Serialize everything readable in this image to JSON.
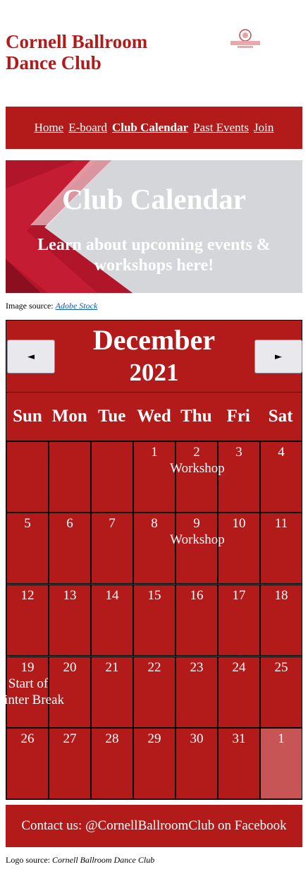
{
  "site": {
    "title": "Cornell Ballroom Dance Club"
  },
  "nav": {
    "items": [
      {
        "label": "Home",
        "active": false
      },
      {
        "label": "E-board",
        "active": false
      },
      {
        "label": "Club Calendar",
        "active": true
      },
      {
        "label": "Past Events",
        "active": false
      },
      {
        "label": "Join",
        "active": false
      }
    ]
  },
  "banner": {
    "title": "Club Calendar",
    "subtitle": "Learn about upcoming events & workshops here!"
  },
  "image_source": {
    "label": "Image source:",
    "link": "Adobe Stock"
  },
  "calendar": {
    "month": "December",
    "year": "2021",
    "prev_label": "◄",
    "next_label": "►",
    "weekdays": [
      "Sun",
      "Mon",
      "Tue",
      "Wed",
      "Thu",
      "Fri",
      "Sat"
    ],
    "weeks": [
      [
        {
          "day": "",
          "event": ""
        },
        {
          "day": "",
          "event": ""
        },
        {
          "day": "",
          "event": ""
        },
        {
          "day": "1",
          "event": ""
        },
        {
          "day": "2",
          "event": "Workshop"
        },
        {
          "day": "3",
          "event": ""
        },
        {
          "day": "4",
          "event": ""
        }
      ],
      [
        {
          "day": "5",
          "event": ""
        },
        {
          "day": "6",
          "event": ""
        },
        {
          "day": "7",
          "event": ""
        },
        {
          "day": "8",
          "event": ""
        },
        {
          "day": "9",
          "event": "Workshop"
        },
        {
          "day": "10",
          "event": ""
        },
        {
          "day": "11",
          "event": ""
        }
      ],
      [
        {
          "day": "12",
          "event": ""
        },
        {
          "day": "13",
          "event": ""
        },
        {
          "day": "14",
          "event": ""
        },
        {
          "day": "15",
          "event": ""
        },
        {
          "day": "16",
          "event": ""
        },
        {
          "day": "17",
          "event": ""
        },
        {
          "day": "18",
          "event": ""
        }
      ],
      [
        {
          "day": "19",
          "event": "Start of\nWinter Break"
        },
        {
          "day": "20",
          "event": ""
        },
        {
          "day": "21",
          "event": ""
        },
        {
          "day": "22",
          "event": ""
        },
        {
          "day": "23",
          "event": ""
        },
        {
          "day": "24",
          "event": ""
        },
        {
          "day": "25",
          "event": ""
        }
      ],
      [
        {
          "day": "26",
          "event": ""
        },
        {
          "day": "27",
          "event": ""
        },
        {
          "day": "28",
          "event": ""
        },
        {
          "day": "29",
          "event": ""
        },
        {
          "day": "30",
          "event": ""
        },
        {
          "day": "31",
          "event": ""
        },
        {
          "day": "1",
          "event": "",
          "other_month": true
        }
      ]
    ]
  },
  "footer": {
    "contact": "Contact us: @CornellBallroomClub on Facebook"
  },
  "logo_source": {
    "label": "Logo source:",
    "source": "Cornell Ballroom Dance Club"
  },
  "colors": {
    "brand": "#b31b1b",
    "other_month": "#c85555",
    "banner_grey": "#d4d6d9"
  }
}
